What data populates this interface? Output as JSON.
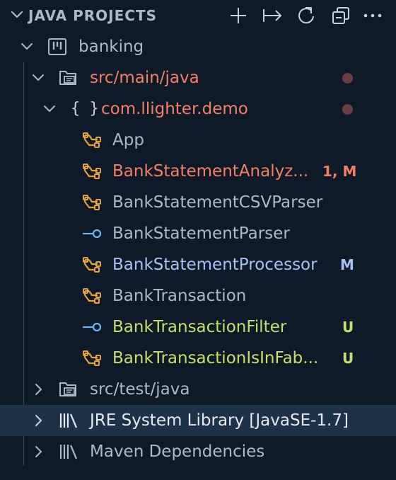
{
  "panel": {
    "title": "JAVA PROJECTS",
    "actions": [
      {
        "name": "new-icon"
      },
      {
        "name": "link-with-editor-icon"
      },
      {
        "name": "refresh-icon"
      },
      {
        "name": "collapse-all-icon"
      },
      {
        "name": "more-actions-icon"
      }
    ]
  },
  "tree": {
    "project": {
      "label": "banking",
      "icon": "project-icon"
    },
    "src_main": {
      "label": "src/main/java",
      "color": "#f47f67",
      "icon": "source-folder-icon",
      "decoration": "modified-dot"
    },
    "package": {
      "label": "com.llighter.demo",
      "color": "#f47f67",
      "icon": "package-braces-icon",
      "decoration": "modified-dot"
    },
    "files": [
      {
        "label": "App",
        "kind": "class",
        "color": "#aeb8c6",
        "badge": ""
      },
      {
        "label": "BankStatementAnalyz...",
        "kind": "class",
        "color": "#f47f67",
        "badge": "1, M",
        "badge_color": "#f47f67"
      },
      {
        "label": "BankStatementCSVParser",
        "kind": "class",
        "color": "#aeb8c6",
        "badge": ""
      },
      {
        "label": "BankStatementParser",
        "kind": "interface",
        "color": "#aeb8c6",
        "badge": ""
      },
      {
        "label": "BankStatementProcessor",
        "kind": "class",
        "color": "#a9c0f5",
        "badge": "M",
        "badge_color": "#a9c0f5"
      },
      {
        "label": "BankTransaction",
        "kind": "class",
        "color": "#aeb8c6",
        "badge": ""
      },
      {
        "label": "BankTransactionFilter",
        "kind": "interface",
        "color": "#c8e06b",
        "badge": "U",
        "badge_color": "#c8e06b"
      },
      {
        "label": "BankTransactionIsInFab...",
        "kind": "class",
        "color": "#c8e06b",
        "badge": "U",
        "badge_color": "#c8e06b"
      }
    ],
    "src_test": {
      "label": "src/test/java",
      "color": "#aeb8c6",
      "icon": "source-folder-icon"
    },
    "jre": {
      "label": "JRE System Library [JavaSE-1.7]",
      "color": "#e6ebf2",
      "icon": "library-icon",
      "selected": true
    },
    "maven": {
      "label": "Maven Dependencies",
      "color": "#aeb8c6",
      "icon": "library-icon"
    }
  },
  "colors": {
    "background": "#0f1a29",
    "selection": "#1d3148",
    "class_icon": "#e8a23c",
    "interface_icon": "#6fb3f2",
    "default_text": "#aeb8c6"
  }
}
